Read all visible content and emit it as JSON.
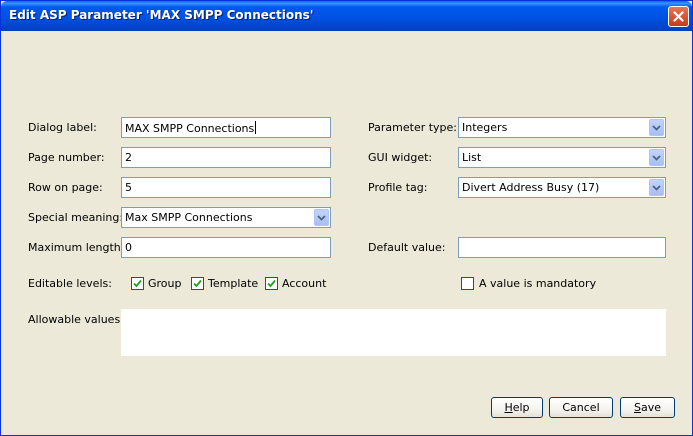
{
  "window": {
    "title": "Edit ASP Parameter 'MAX SMPP Connections'"
  },
  "form": {
    "dialog_label": {
      "label": "Dialog label:",
      "value": "MAX SMPP Connections"
    },
    "page_number": {
      "label": "Page number:",
      "value": "2"
    },
    "row_on_page": {
      "label": "Row on page:",
      "value": "5"
    },
    "special_meaning": {
      "label": "Special meaning:",
      "value": "Max SMPP Connections"
    },
    "maximum_length": {
      "label": "Maximum length:",
      "value": "0"
    },
    "parameter_type": {
      "label": "Parameter type:",
      "value": "Integers"
    },
    "gui_widget": {
      "label": "GUI widget:",
      "value": "List"
    },
    "profile_tag": {
      "label": "Profile tag:",
      "value": "Divert Address Busy (17)"
    },
    "default_value": {
      "label": "Default value:",
      "value": ""
    },
    "editable_levels": {
      "label": "Editable levels:",
      "options": [
        {
          "label": "Group",
          "checked": true
        },
        {
          "label": "Template",
          "checked": true
        },
        {
          "label": "Account",
          "checked": true
        }
      ]
    },
    "mandatory": {
      "label": "A value is mandatory",
      "checked": false
    },
    "allowable_values": {
      "label": "Allowable values:",
      "value": ""
    }
  },
  "buttons": {
    "help": {
      "pre": "",
      "u": "H",
      "post": "elp"
    },
    "cancel": {
      "label": "Cancel"
    },
    "save": {
      "pre": "",
      "u": "S",
      "post": "ave"
    }
  },
  "colors": {
    "titlebar": "#0054E3",
    "dialog_bg": "#ECE9D8",
    "checkmark": "#21A121",
    "field_border": "#7F9DB9"
  }
}
